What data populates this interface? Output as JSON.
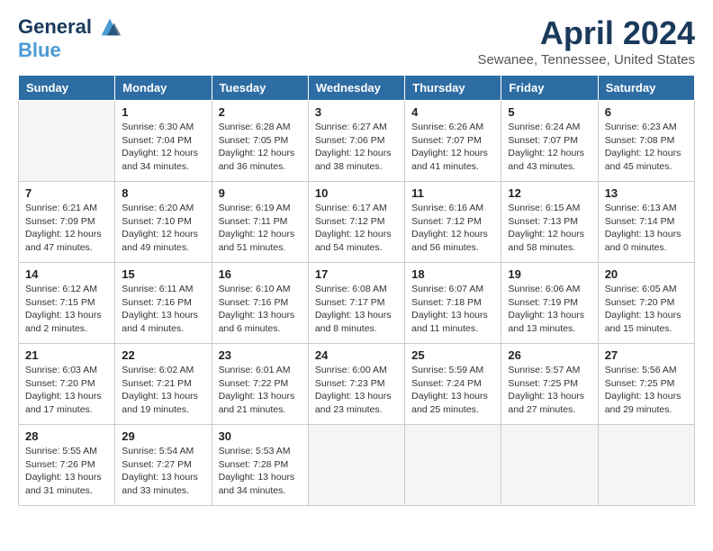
{
  "header": {
    "logo_line1": "General",
    "logo_line2": "Blue",
    "title": "April 2024",
    "subtitle": "Sewanee, Tennessee, United States"
  },
  "weekdays": [
    "Sunday",
    "Monday",
    "Tuesday",
    "Wednesday",
    "Thursday",
    "Friday",
    "Saturday"
  ],
  "weeks": [
    [
      {
        "day": "",
        "info": ""
      },
      {
        "day": "1",
        "info": "Sunrise: 6:30 AM\nSunset: 7:04 PM\nDaylight: 12 hours\nand 34 minutes."
      },
      {
        "day": "2",
        "info": "Sunrise: 6:28 AM\nSunset: 7:05 PM\nDaylight: 12 hours\nand 36 minutes."
      },
      {
        "day": "3",
        "info": "Sunrise: 6:27 AM\nSunset: 7:06 PM\nDaylight: 12 hours\nand 38 minutes."
      },
      {
        "day": "4",
        "info": "Sunrise: 6:26 AM\nSunset: 7:07 PM\nDaylight: 12 hours\nand 41 minutes."
      },
      {
        "day": "5",
        "info": "Sunrise: 6:24 AM\nSunset: 7:07 PM\nDaylight: 12 hours\nand 43 minutes."
      },
      {
        "day": "6",
        "info": "Sunrise: 6:23 AM\nSunset: 7:08 PM\nDaylight: 12 hours\nand 45 minutes."
      }
    ],
    [
      {
        "day": "7",
        "info": "Sunrise: 6:21 AM\nSunset: 7:09 PM\nDaylight: 12 hours\nand 47 minutes."
      },
      {
        "day": "8",
        "info": "Sunrise: 6:20 AM\nSunset: 7:10 PM\nDaylight: 12 hours\nand 49 minutes."
      },
      {
        "day": "9",
        "info": "Sunrise: 6:19 AM\nSunset: 7:11 PM\nDaylight: 12 hours\nand 51 minutes."
      },
      {
        "day": "10",
        "info": "Sunrise: 6:17 AM\nSunset: 7:12 PM\nDaylight: 12 hours\nand 54 minutes."
      },
      {
        "day": "11",
        "info": "Sunrise: 6:16 AM\nSunset: 7:12 PM\nDaylight: 12 hours\nand 56 minutes."
      },
      {
        "day": "12",
        "info": "Sunrise: 6:15 AM\nSunset: 7:13 PM\nDaylight: 12 hours\nand 58 minutes."
      },
      {
        "day": "13",
        "info": "Sunrise: 6:13 AM\nSunset: 7:14 PM\nDaylight: 13 hours\nand 0 minutes."
      }
    ],
    [
      {
        "day": "14",
        "info": "Sunrise: 6:12 AM\nSunset: 7:15 PM\nDaylight: 13 hours\nand 2 minutes."
      },
      {
        "day": "15",
        "info": "Sunrise: 6:11 AM\nSunset: 7:16 PM\nDaylight: 13 hours\nand 4 minutes."
      },
      {
        "day": "16",
        "info": "Sunrise: 6:10 AM\nSunset: 7:16 PM\nDaylight: 13 hours\nand 6 minutes."
      },
      {
        "day": "17",
        "info": "Sunrise: 6:08 AM\nSunset: 7:17 PM\nDaylight: 13 hours\nand 8 minutes."
      },
      {
        "day": "18",
        "info": "Sunrise: 6:07 AM\nSunset: 7:18 PM\nDaylight: 13 hours\nand 11 minutes."
      },
      {
        "day": "19",
        "info": "Sunrise: 6:06 AM\nSunset: 7:19 PM\nDaylight: 13 hours\nand 13 minutes."
      },
      {
        "day": "20",
        "info": "Sunrise: 6:05 AM\nSunset: 7:20 PM\nDaylight: 13 hours\nand 15 minutes."
      }
    ],
    [
      {
        "day": "21",
        "info": "Sunrise: 6:03 AM\nSunset: 7:20 PM\nDaylight: 13 hours\nand 17 minutes."
      },
      {
        "day": "22",
        "info": "Sunrise: 6:02 AM\nSunset: 7:21 PM\nDaylight: 13 hours\nand 19 minutes."
      },
      {
        "day": "23",
        "info": "Sunrise: 6:01 AM\nSunset: 7:22 PM\nDaylight: 13 hours\nand 21 minutes."
      },
      {
        "day": "24",
        "info": "Sunrise: 6:00 AM\nSunset: 7:23 PM\nDaylight: 13 hours\nand 23 minutes."
      },
      {
        "day": "25",
        "info": "Sunrise: 5:59 AM\nSunset: 7:24 PM\nDaylight: 13 hours\nand 25 minutes."
      },
      {
        "day": "26",
        "info": "Sunrise: 5:57 AM\nSunset: 7:25 PM\nDaylight: 13 hours\nand 27 minutes."
      },
      {
        "day": "27",
        "info": "Sunrise: 5:56 AM\nSunset: 7:25 PM\nDaylight: 13 hours\nand 29 minutes."
      }
    ],
    [
      {
        "day": "28",
        "info": "Sunrise: 5:55 AM\nSunset: 7:26 PM\nDaylight: 13 hours\nand 31 minutes."
      },
      {
        "day": "29",
        "info": "Sunrise: 5:54 AM\nSunset: 7:27 PM\nDaylight: 13 hours\nand 33 minutes."
      },
      {
        "day": "30",
        "info": "Sunrise: 5:53 AM\nSunset: 7:28 PM\nDaylight: 13 hours\nand 34 minutes."
      },
      {
        "day": "",
        "info": ""
      },
      {
        "day": "",
        "info": ""
      },
      {
        "day": "",
        "info": ""
      },
      {
        "day": "",
        "info": ""
      }
    ]
  ]
}
